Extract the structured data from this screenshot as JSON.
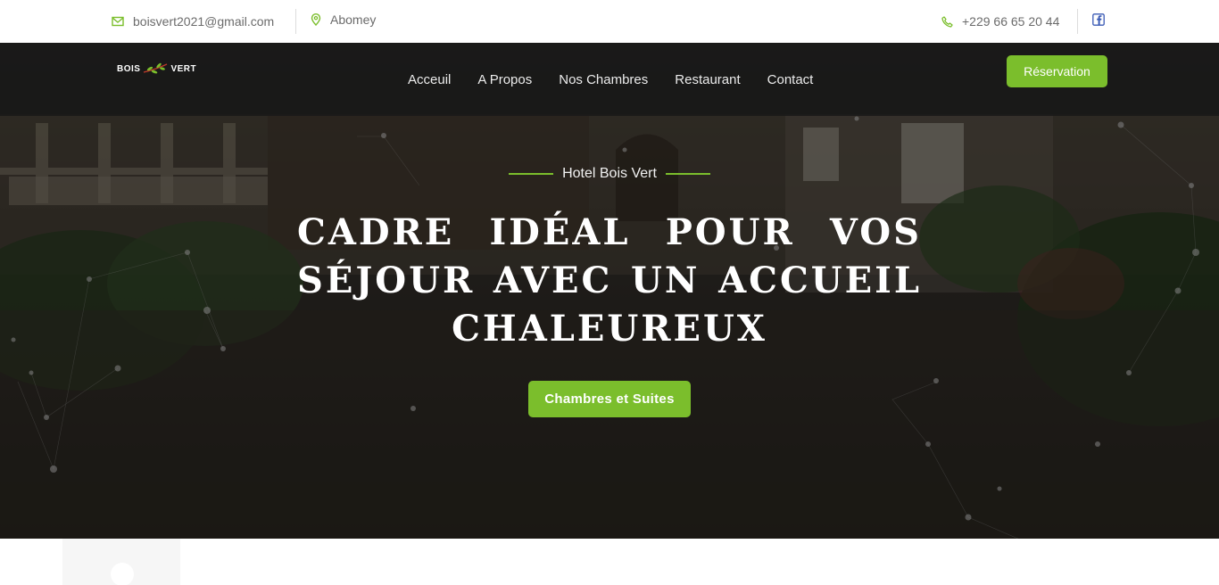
{
  "topbar": {
    "email": "boisvert2021@gmail.com",
    "location": "Abomey",
    "phone": "+229 66 65 20 44",
    "icons": {
      "email": "mail-icon",
      "location": "map-pin-icon",
      "phone": "phone-icon",
      "social": "facebook-icon"
    }
  },
  "brand": {
    "name_left": "BOIS",
    "name_right": "VERT",
    "accent_color": "#7bbe2c"
  },
  "nav": {
    "items": [
      {
        "label": "Acceuil"
      },
      {
        "label": "A Propos"
      },
      {
        "label": "Nos Chambres"
      },
      {
        "label": "Restaurant"
      },
      {
        "label": "Contact"
      }
    ],
    "cta": "Réservation"
  },
  "hero": {
    "subtitle": "Hotel Bois Vert",
    "headline": "CADRE IDÉAL POUR VOS SÉJOUR AVEC UN ACCUEIL CHALEUREUX",
    "button": "Chambres et Suites"
  }
}
